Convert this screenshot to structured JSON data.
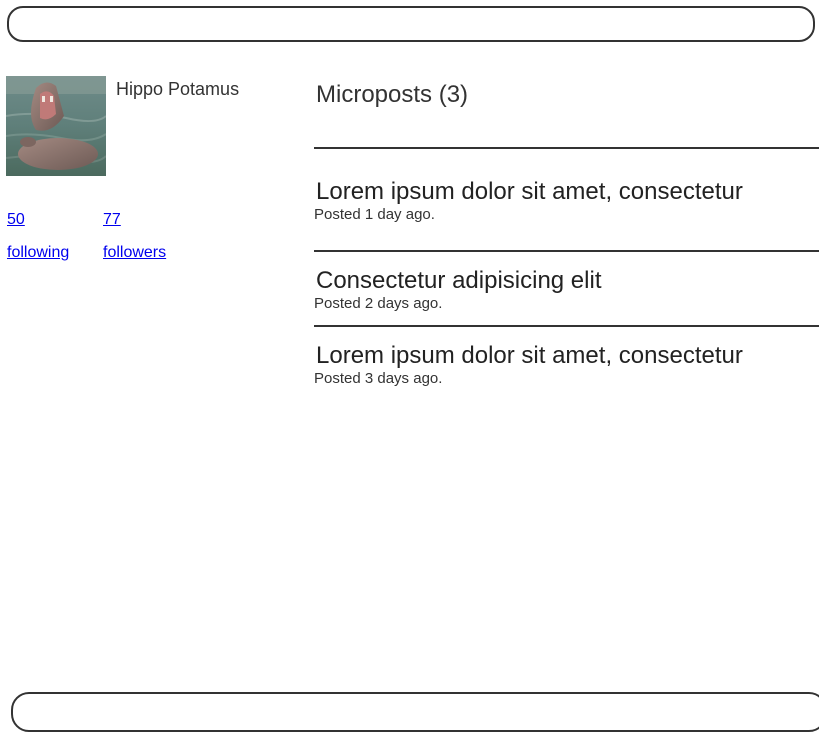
{
  "user": {
    "name": "Hippo Potamus",
    "avatar_alt": "hippo-photo"
  },
  "stats": {
    "following_count": "50",
    "following_label": "following",
    "followers_count": "77",
    "followers_label": "followers"
  },
  "feed": {
    "title": "Microposts (3)",
    "posts": [
      {
        "content": "Lorem ipsum dolor sit amet, consectetur",
        "time": "Posted 1 day ago."
      },
      {
        "content": "Consectetur adipisicing elit",
        "time": "Posted 2 days ago."
      },
      {
        "content": "Lorem ipsum dolor sit amet, consectetur",
        "time": "Posted 3 days ago."
      }
    ]
  },
  "colors": {
    "border": "#333333",
    "link": "#0000ee",
    "text": "#333333"
  }
}
